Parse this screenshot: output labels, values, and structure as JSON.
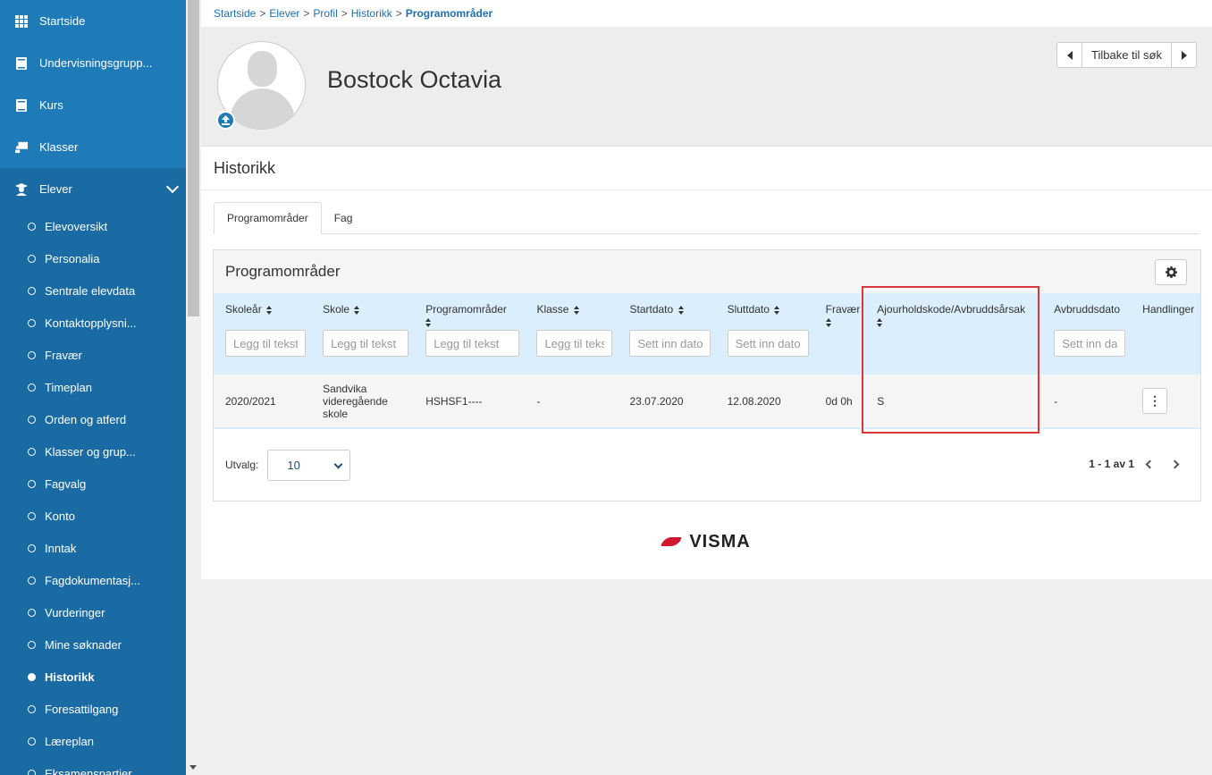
{
  "sidebar": {
    "top_items": [
      {
        "label": "Startside",
        "icon": "grid-icon"
      },
      {
        "label": "Undervisningsgrupp...",
        "icon": "book-icon"
      },
      {
        "label": "Kurs",
        "icon": "book-icon"
      },
      {
        "label": "Klasser",
        "icon": "presentation-icon"
      },
      {
        "label": "Elever",
        "icon": "student-icon"
      }
    ],
    "sub_items": [
      "Elevoversikt",
      "Personalia",
      "Sentrale elevdata",
      "Kontaktopplysni...",
      "Fravær",
      "Timeplan",
      "Orden og atferd",
      "Klasser og grup...",
      "Fagvalg",
      "Konto",
      "Inntak",
      "Fagdokumentasj...",
      "Vurderinger",
      "Mine søknader",
      "Historikk",
      "Foresattilgang",
      "Læreplan",
      "Eksamenspartier"
    ],
    "current": "Historikk"
  },
  "breadcrumb": {
    "items": [
      "Startside",
      "Elever",
      "Profil",
      "Historikk"
    ],
    "separator": ">",
    "current": "Programområder"
  },
  "profile": {
    "name": "Bostock Octavia",
    "back_button": "Tilbake til søk"
  },
  "section_title": "Historikk",
  "tabs": [
    "Programområder",
    "Fag"
  ],
  "panel": {
    "title": "Programområder",
    "columns": [
      {
        "label": "Skoleår",
        "sortable": true,
        "filter": "Legg til tekst"
      },
      {
        "label": "Skole",
        "sortable": true,
        "filter": "Legg til tekst"
      },
      {
        "label": "Programområder",
        "sortable": true,
        "filter": "Legg til tekst"
      },
      {
        "label": "Klasse",
        "sortable": true,
        "filter": "Legg til tekst"
      },
      {
        "label": "Startdato",
        "sortable": true,
        "filter": "Sett inn dato"
      },
      {
        "label": "Sluttdato",
        "sortable": true,
        "filter": "Sett inn dato"
      },
      {
        "label": "Fravær",
        "sortable": true,
        "filter": ""
      },
      {
        "label": "Ajourholdskode/Avbruddsårsak",
        "sortable": true,
        "filter": ""
      },
      {
        "label": "Avbruddsdato",
        "sortable": false,
        "filter": "Sett inn dato"
      },
      {
        "label": "Handlinger",
        "sortable": false,
        "filter": ""
      }
    ],
    "rows": [
      [
        "2020/2021",
        "Sandvika videregående skole",
        "HSHSF1----",
        "-",
        "23.07.2020",
        "12.08.2020",
        "0d 0h",
        "S",
        "-",
        ""
      ]
    ],
    "footer": {
      "utvalg_label": "Utvalg:",
      "page_size": "10",
      "range": "1 - 1 av 1"
    }
  },
  "logo_text": "VISMA",
  "colors": {
    "sidebar": "#1a6aa3",
    "header_row": "#dbeefb",
    "highlight": "#d9373b"
  }
}
